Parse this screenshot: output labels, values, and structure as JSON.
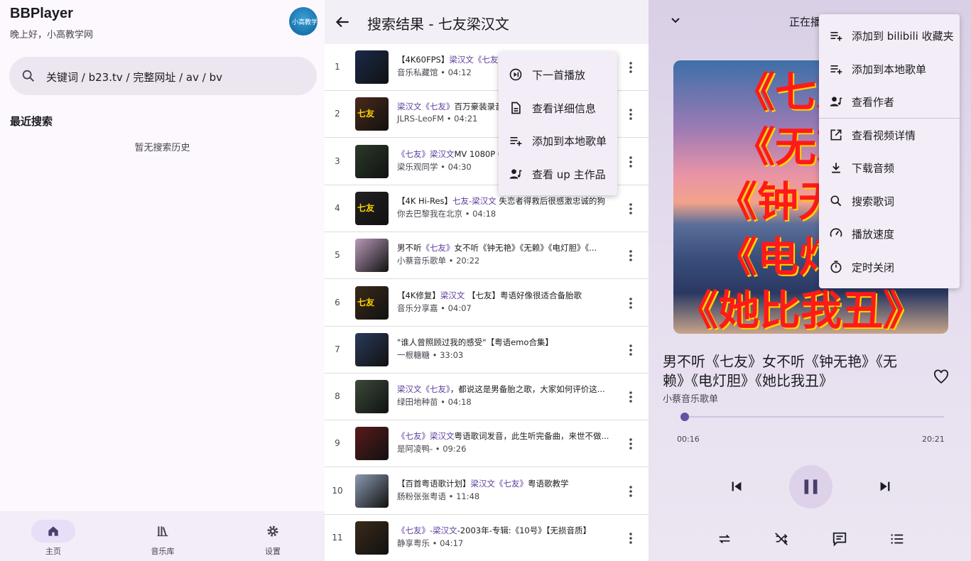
{
  "home": {
    "app_title": "BBPlayer",
    "greeting": "晚上好，小高教学网",
    "avatar_text": "小高教学网",
    "search_placeholder": "关键词 / b23.tv / 完整网址 / av / bv",
    "recent_title": "最近搜索",
    "empty_history": "暂无搜索历史",
    "nav": [
      {
        "label": "主页",
        "icon": "home-icon",
        "active": true
      },
      {
        "label": "音乐库",
        "icon": "library-icon",
        "active": false
      },
      {
        "label": "设置",
        "icon": "gear-icon",
        "active": false
      }
    ]
  },
  "search": {
    "title": "搜索结果 - 七友梁汉文",
    "results": [
      {
        "num": "1",
        "title_pre": "【4K60FPS】",
        "title_hl": "梁汉文《七友",
        "title_post": "",
        "meta": "音乐私藏馆 • 04:12",
        "thumb_text": "",
        "thumb_color": "#1a2a4a"
      },
      {
        "num": "2",
        "title_pre": "",
        "title_hl": "梁汉文《七友》",
        "title_post": "百万豪装录音",
        "meta": "JLRS-LeoFM • 04:21",
        "thumb_text": "七友",
        "thumb_color": "#4a2a1a"
      },
      {
        "num": "3",
        "title_pre": "",
        "title_hl": "《七友》梁汉文",
        "title_post": "MV 1080P 6",
        "meta": "梁乐观同学 • 04:30",
        "thumb_text": "",
        "thumb_color": "#2a3a2a"
      },
      {
        "num": "4",
        "title_pre": "【4K Hi-Res】",
        "title_hl": "七友-梁汉文",
        "title_post": " 失恋者得救后很感激忠诚的狗",
        "meta": "你去巴黎我在北京 • 04:18",
        "thumb_text": "七友",
        "thumb_color": "#222222"
      },
      {
        "num": "5",
        "title_pre": "男不听",
        "title_hl": "《七友》",
        "title_post": "女不听《钟无艳》《无赖》《电灯胆》《...",
        "meta": "小蔡音乐歌单 • 20:22",
        "thumb_text": "",
        "thumb_color": "#b89ab8"
      },
      {
        "num": "6",
        "title_pre": "【4K修复】",
        "title_hl": "梁汉文",
        "title_post": " 【七友】粤语好像很适合备胎歌",
        "meta": "音乐分享嘉 • 04:07",
        "thumb_text": "七友",
        "thumb_color": "#3a2a1a"
      },
      {
        "num": "7",
        "title_pre": "\"谁人曾照顾过我的感受\"【粤语emo合集】",
        "title_hl": "",
        "title_post": "",
        "meta": "一根糖糖 • 33:03",
        "thumb_text": "",
        "thumb_color": "#2a3a5a"
      },
      {
        "num": "8",
        "title_pre": "",
        "title_hl": "梁汉文《七友》",
        "title_post": "，都说这是男备胎之歌，大家如何评价这...",
        "meta": "绿田地种苗 • 04:18",
        "thumb_text": "",
        "thumb_color": "#3a4a3a"
      },
      {
        "num": "9",
        "title_pre": "",
        "title_hl": "《七友》梁汉文",
        "title_post": "粤语歌词发音，此生听完备曲，来世不做...",
        "meta": "是阿凌鸭- • 09:26",
        "thumb_text": "",
        "thumb_color": "#5a1a1a"
      },
      {
        "num": "10",
        "title_pre": "【百首粤语歌计划】",
        "title_hl": "梁汉文《七友》",
        "title_post": "粤语歌教学",
        "meta": "肠粉张张粤语 • 11:48",
        "thumb_text": "",
        "thumb_color": "#8a9ab0"
      },
      {
        "num": "11",
        "title_pre": "",
        "title_hl": "《七友》-梁汉文",
        "title_post": "-2003年-专辑:《10号》【无损音质】",
        "meta": "静享粤乐 • 04:17",
        "thumb_text": "",
        "thumb_color": "#3a2a1a"
      }
    ],
    "menu": [
      {
        "label": "下一首播放",
        "icon": "play-next-icon"
      },
      {
        "label": "查看详细信息",
        "icon": "document-icon"
      },
      {
        "label": "添加到本地歌单",
        "icon": "playlist-add-icon"
      },
      {
        "label": "查看 up 主作品",
        "icon": "person-music-icon"
      }
    ]
  },
  "player": {
    "header_title": "正在播放",
    "cover_lines": [
      "《七友》",
      "《无赖》",
      "《钟无艳》",
      "《电灯胆》",
      "《她比我丑》"
    ],
    "song_title": "男不听《七友》女不听《钟无艳》《无赖》《电灯胆》《她比我丑》",
    "artist": "小蔡音乐歌单",
    "current_time": "00:16",
    "duration": "20:21",
    "progress": 0.013,
    "menu": [
      {
        "label": "添加到 bilibili 收藏夹",
        "icon": "playlist-add-icon"
      },
      {
        "label": "添加到本地歌单",
        "icon": "playlist-add-icon"
      },
      {
        "label": "查看作者",
        "icon": "person-music-icon"
      },
      {
        "label": "查看视频详情",
        "icon": "open-external-icon"
      },
      {
        "label": "下载音频",
        "icon": "download-icon"
      },
      {
        "label": "搜索歌词",
        "icon": "search-icon"
      },
      {
        "label": "播放速度",
        "icon": "speed-icon"
      },
      {
        "label": "定时关闭",
        "icon": "timer-icon"
      }
    ]
  },
  "colors": {
    "accent": "#6750a4",
    "highlight": "#5b3d9e",
    "cover_text": "#ff1a1a"
  }
}
